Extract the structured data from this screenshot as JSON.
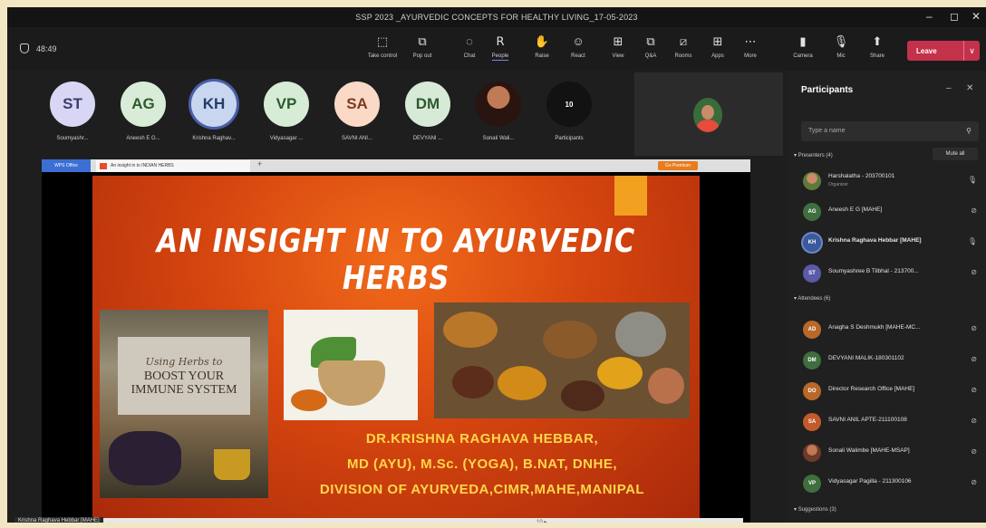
{
  "window": {
    "title": "SSP 2023 _AYURVEDIC CONCEPTS FOR HEALTHY LIVING_17-05-2023",
    "minimize": "–",
    "maximize": "◻",
    "close": "✕"
  },
  "meeting": {
    "timer": "48:49"
  },
  "toolbar": {
    "buttons": [
      {
        "label": "Take control",
        "icon": "⬚"
      },
      {
        "label": "Pop out",
        "icon": "⧉"
      },
      {
        "label": "Chat",
        "icon": "◌"
      },
      {
        "label": "People",
        "icon": "ꓣ"
      },
      {
        "label": "Raise",
        "icon": "✋"
      },
      {
        "label": "React",
        "icon": "☺"
      },
      {
        "label": "View",
        "icon": "⊞"
      },
      {
        "label": "Q&A",
        "icon": "⧉"
      },
      {
        "label": "Rooms",
        "icon": "⧄"
      },
      {
        "label": "Apps",
        "icon": "⊞"
      },
      {
        "label": "More",
        "icon": "⋯"
      },
      {
        "label": "Camera",
        "icon": "▮"
      },
      {
        "label": "Mic",
        "icon": "🎙"
      },
      {
        "label": "Share",
        "icon": "⬆"
      }
    ],
    "leave_label": "Leave",
    "leave_dropdown": "∨"
  },
  "participants_strip": [
    {
      "initials": "ST",
      "name": "Soumyashr...",
      "bg": "#d7d7f5",
      "fg": "#3b3b6e"
    },
    {
      "initials": "AG",
      "name": "Aneesh E G...",
      "bg": "#d8ecd8",
      "fg": "#2f5a2f"
    },
    {
      "initials": "KH",
      "name": "Krishna Raghav...",
      "bg": "#c9d6f0",
      "fg": "#233b66"
    },
    {
      "initials": "VP",
      "name": "Vidyasagar ...",
      "bg": "#d6ecd6",
      "fg": "#2e5a2e"
    },
    {
      "initials": "SA",
      "name": "SAVNI ANI...",
      "bg": "#fad9c6",
      "fg": "#7a3d1e"
    },
    {
      "initials": "DM",
      "name": "DEVYANI ...",
      "bg": "#d7ead7",
      "fg": "#2e5a2e"
    },
    {
      "initials": "",
      "name": "Sonali Wali...",
      "bg": "#6d3a2b",
      "fg": "#fff"
    },
    {
      "initials": "10",
      "name": "Participants",
      "bg": "#121212",
      "fg": "#fff"
    }
  ],
  "slide_app": {
    "app_tab": "WPS Office",
    "doc_tab": "An insight in to INDIAN HERBS",
    "premium": "Go Premium"
  },
  "slide": {
    "title": "AN INSIGHT IN TO AYURVEDIC HERBS",
    "image1_line1": "Using Herbs to",
    "image1_line2": "BOOST YOUR IMMUNE SYSTEM",
    "author_line1": "DR.KRISHNA RAGHAVA HEBBAR,",
    "author_line2": "MD (AYU), M.Sc. (YOGA), B.NAT, DNHE,",
    "author_line3": "DIVISION OF AYURVEDA,CIMR,MAHE,MANIPAL",
    "page": "10 ▸"
  },
  "panel": {
    "title": "Participants",
    "search_placeholder": "Type a name",
    "presenters_header": "Presenters (4)",
    "mute_all": "Mute all",
    "presenters": [
      {
        "initials": "",
        "name": "Harshalatha - 203700101",
        "sub": "Organizer",
        "bg": "#5c7a3a"
      },
      {
        "initials": "AG",
        "name": "Aneesh E G [MAHE]",
        "sub": "",
        "bg": "#3f6e3f"
      },
      {
        "initials": "KH",
        "name": "Krishna Raghava Hebbar [MAHE]",
        "sub": "",
        "bg": "#3a5a99"
      },
      {
        "initials": "ST",
        "name": "Soumyashree B Tilbhal - 213700...",
        "sub": "",
        "bg": "#5a5aa8"
      }
    ],
    "attendees_header": "Attendees (6)",
    "attendees": [
      {
        "initials": "AD",
        "name": "Anagha S Deshmukh [MAHE-MC...",
        "bg": "#b8692a"
      },
      {
        "initials": "DM",
        "name": "DEVYANI MALIK-180301102",
        "bg": "#3f6e3f"
      },
      {
        "initials": "DO",
        "name": "Director Research Office [MAHE]",
        "bg": "#b8692a"
      },
      {
        "initials": "SA",
        "name": "SAVNI ANIL APTE-211100108",
        "bg": "#c25a2a"
      },
      {
        "initials": "",
        "name": "Sonali Walimbe [MAHE-MSAP]",
        "bg": "#6d3a2b"
      },
      {
        "initials": "VP",
        "name": "Vidyasagar Pagilla - 211300106",
        "bg": "#3f6e3f"
      }
    ],
    "suggestions_header": "Suggestions (3)"
  },
  "presenter_label": "Krishna Raghava Hebbar [MAHE]"
}
